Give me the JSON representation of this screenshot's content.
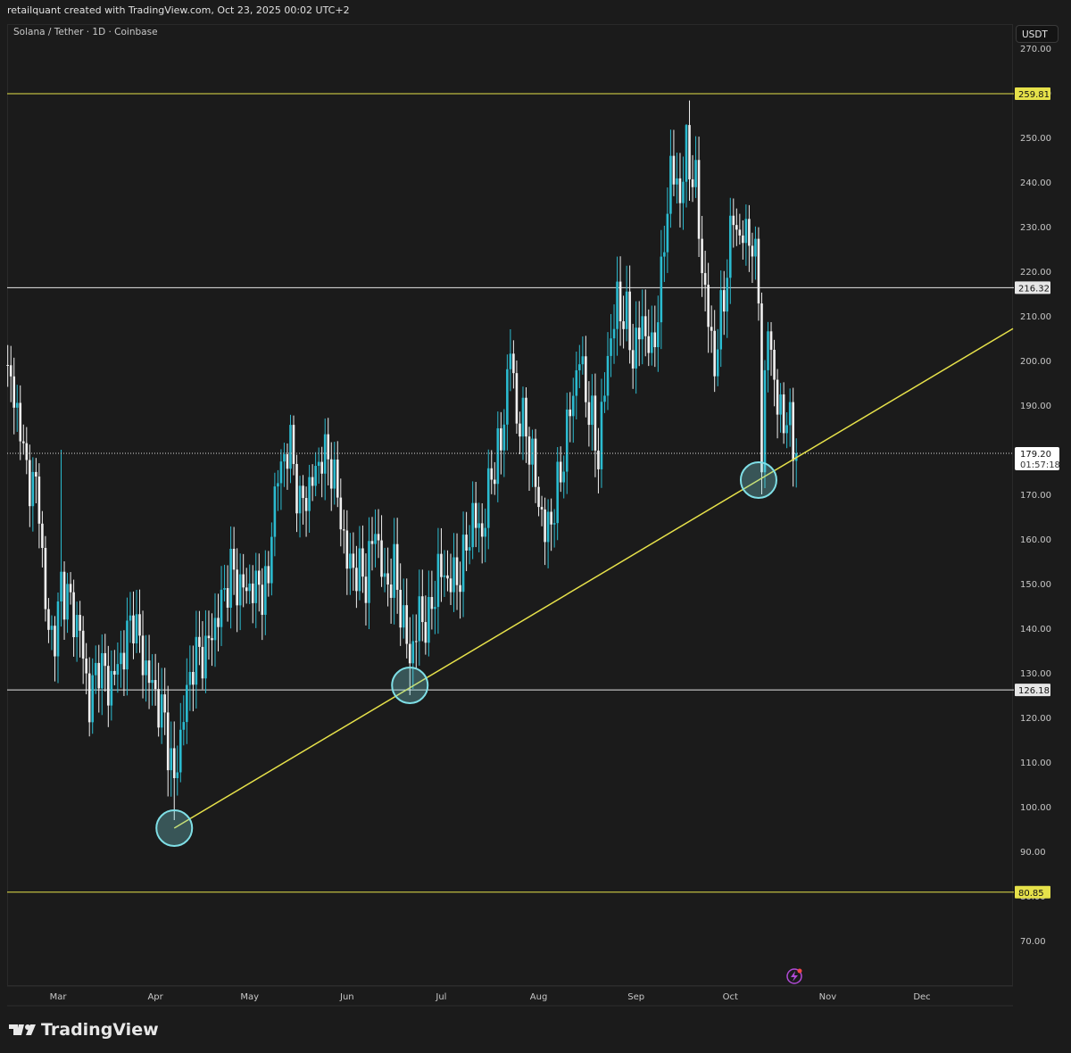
{
  "header": {
    "attribution": "retailquant created with TradingView.com, Oct 23, 2025 00:02 UTC+2"
  },
  "symbol": {
    "title": "Solana / Tether · 1D · Coinbase",
    "currency": "USDT"
  },
  "brand": {
    "name": "TradingView"
  },
  "colors": {
    "up": "#2bbbd0",
    "down": "#f0f0f0",
    "level_yellow": "#e6e14a",
    "level_white": "#e6e6e6",
    "trendline": "#e6e14a",
    "circle": "#7fdfe6"
  },
  "chart_data": {
    "type": "candlestick",
    "title": "Solana / Tether · 1D · Coinbase",
    "ylim": [
      60,
      272
    ],
    "y_ticks": [
      "270.00",
      "260.00",
      "250.00",
      "240.00",
      "230.00",
      "220.00",
      "210.00",
      "200.00",
      "190.00",
      "180.00",
      "170.00",
      "160.00",
      "150.00",
      "140.00",
      "130.00",
      "120.00",
      "110.00",
      "100.00",
      "90.00",
      "80.00",
      "70.00"
    ],
    "x_ticks": [
      {
        "label": "Mar",
        "day": 0
      },
      {
        "label": "Apr",
        "day": 31
      },
      {
        "label": "May",
        "day": 61
      },
      {
        "label": "Jun",
        "day": 92
      },
      {
        "label": "Jul",
        "day": 122
      },
      {
        "label": "Aug",
        "day": 153
      },
      {
        "label": "Sep",
        "day": 184
      },
      {
        "label": "Oct",
        "day": 214
      },
      {
        "label": "Nov",
        "day": 245
      },
      {
        "label": "Dec",
        "day": 275
      }
    ],
    "x_range_days": [
      -16,
      304
    ],
    "close_keypoints_day_price": [
      [
        -16,
        197
      ],
      [
        -13,
        189
      ],
      [
        -10,
        175
      ],
      [
        -6,
        169
      ],
      [
        -4,
        143
      ],
      [
        -1,
        137
      ],
      [
        1,
        150
      ],
      [
        4,
        145
      ],
      [
        7,
        139
      ],
      [
        10,
        123
      ],
      [
        13,
        133
      ],
      [
        16,
        127
      ],
      [
        20,
        133
      ],
      [
        24,
        143
      ],
      [
        27,
        133
      ],
      [
        30,
        127
      ],
      [
        34,
        119
      ],
      [
        37,
        105
      ],
      [
        40,
        121
      ],
      [
        43,
        133
      ],
      [
        47,
        135
      ],
      [
        51,
        143
      ],
      [
        55,
        153
      ],
      [
        58,
        149
      ],
      [
        62,
        149
      ],
      [
        67,
        149
      ],
      [
        68,
        165
      ],
      [
        71,
        177
      ],
      [
        74,
        181
      ],
      [
        77,
        167
      ],
      [
        81,
        173
      ],
      [
        84,
        179
      ],
      [
        87,
        177
      ],
      [
        90,
        165
      ],
      [
        92,
        155
      ],
      [
        95,
        153
      ],
      [
        98,
        151
      ],
      [
        101,
        163
      ],
      [
        104,
        149
      ],
      [
        107,
        153
      ],
      [
        109,
        145
      ],
      [
        112,
        133
      ],
      [
        115,
        143
      ],
      [
        118,
        141
      ],
      [
        121,
        153
      ],
      [
        124,
        151
      ],
      [
        127,
        151
      ],
      [
        129,
        155
      ],
      [
        132,
        165
      ],
      [
        135,
        161
      ],
      [
        138,
        175
      ],
      [
        141,
        181
      ],
      [
        144,
        203
      ],
      [
        146,
        187
      ],
      [
        149,
        185
      ],
      [
        152,
        173
      ],
      [
        155,
        161
      ],
      [
        158,
        167
      ],
      [
        161,
        179
      ],
      [
        163,
        189
      ],
      [
        166,
        201
      ],
      [
        169,
        189
      ],
      [
        172,
        179
      ],
      [
        175,
        201
      ],
      [
        178,
        213
      ],
      [
        181,
        209
      ],
      [
        183,
        201
      ],
      [
        186,
        209
      ],
      [
        189,
        201
      ],
      [
        192,
        217
      ],
      [
        193,
        227
      ],
      [
        195,
        243
      ],
      [
        198,
        237
      ],
      [
        200,
        247
      ],
      [
        203,
        239
      ],
      [
        205,
        221
      ],
      [
        207,
        209
      ],
      [
        209,
        199
      ],
      [
        212,
        215
      ],
      [
        215,
        233
      ],
      [
        217,
        227
      ],
      [
        220,
        229
      ],
      [
        223,
        217
      ],
      [
        224,
        177
      ],
      [
        226,
        209
      ],
      [
        229,
        189
      ],
      [
        232,
        187
      ],
      [
        235,
        179.2
      ]
    ],
    "wick_extremes": [
      {
        "day": 37,
        "low": 97
      },
      {
        "day": 112,
        "low": 125
      },
      {
        "day": 144,
        "high": 207
      },
      {
        "day": 200,
        "high": 253
      },
      {
        "day": 224,
        "low": 170
      },
      {
        "day": 1,
        "high": 180
      }
    ],
    "horizontal_levels": [
      {
        "price": 259.81,
        "label": "259.81",
        "color": "yellow"
      },
      {
        "price": 216.32,
        "label": "216.32",
        "color": "white"
      },
      {
        "price": 126.18,
        "label": "126.18",
        "color": "white"
      },
      {
        "price": 80.85,
        "label": "80.85",
        "color": "yellow"
      }
    ],
    "trendline": {
      "from": {
        "day": 37,
        "price": 95.2
      },
      "to": {
        "day": 223,
        "price": 173.2
      }
    },
    "touch_points": [
      {
        "day": 37,
        "price": 95.2
      },
      {
        "day": 112,
        "price": 127.2
      },
      {
        "day": 223,
        "price": 173.2
      }
    ],
    "last_price": {
      "label": "179.20",
      "countdown": "01:57:18",
      "price": 179.2
    }
  }
}
